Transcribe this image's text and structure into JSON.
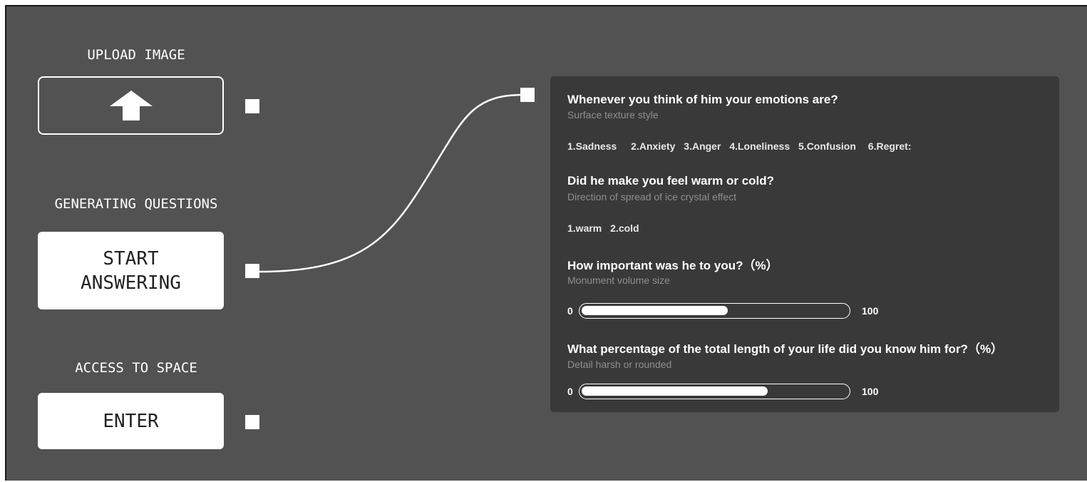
{
  "left": {
    "upload": {
      "label": "UPLOAD IMAGE",
      "icon": "arrow-up-icon"
    },
    "generating": {
      "label": "GENERATING QUESTIONS",
      "button_line1": "START",
      "button_line2": "ANSWERING"
    },
    "access": {
      "label": "ACCESS TO SPACE",
      "button": "ENTER"
    }
  },
  "questions": [
    {
      "title": "Whenever you think of him your emotions are?",
      "subtitle": "Surface texture style",
      "options": [
        "1.Sadness",
        "2.Anxiety",
        "3.Anger",
        "4.Loneliness",
        "5.Confusion",
        "6.Regret:"
      ]
    },
    {
      "title": "Did he make you feel warm or cold?",
      "subtitle": "Direction of spread of ice crystal effect",
      "options": [
        "1.warm",
        "2.cold"
      ]
    },
    {
      "title": "How important was he to you?（%）",
      "subtitle": "Monument volume size",
      "slider": {
        "min": "0",
        "max": "100",
        "value": 55
      }
    },
    {
      "title": "What percentage of the total length of your life did you know him for?（%）",
      "subtitle": "Detail harsh or rounded",
      "slider": {
        "min": "0",
        "max": "100",
        "value": 70
      }
    }
  ],
  "colors": {
    "background": "#525252",
    "panel": "#393939",
    "accent": "#ffffff"
  }
}
